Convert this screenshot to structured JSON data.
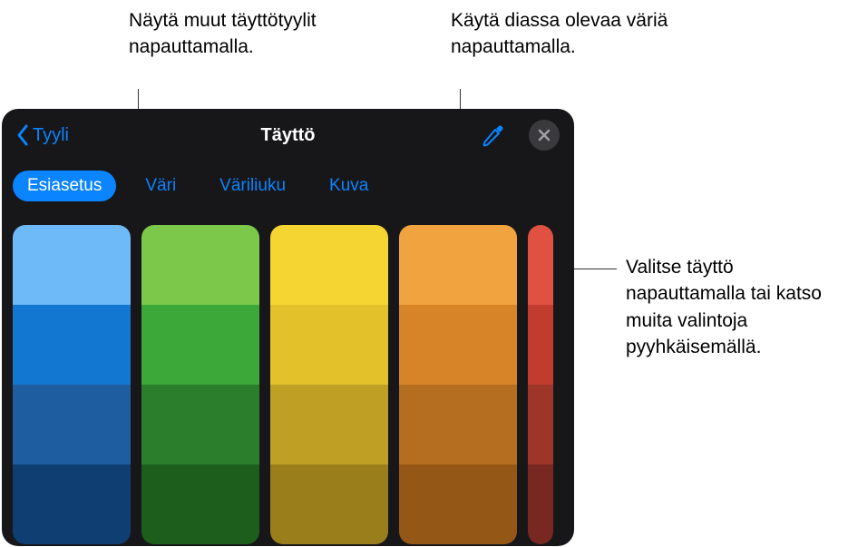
{
  "callouts": {
    "top_left": "Näytä muut täyttötyylit napauttamalla.",
    "top_right": "Käytä diassa olevaa väriä napauttamalla.",
    "side_right": "Valitse täyttö napauttamalla tai katso muita valintoja pyyhkäisemällä."
  },
  "panel": {
    "back_label": "Tyyli",
    "title": "Täyttö",
    "tabs": [
      {
        "label": "Esiasetus",
        "active": true
      },
      {
        "label": "Väri",
        "active": false
      },
      {
        "label": "Väriliuku",
        "active": false
      },
      {
        "label": "Kuva",
        "active": false
      }
    ],
    "icons": {
      "back": "chevron-left-icon",
      "eyedropper": "eyedropper-icon",
      "close": "close-icon"
    }
  },
  "swatches": {
    "columns": [
      [
        "#6eb9f7",
        "#1177d1",
        "#1e5da0",
        "#0f3e72"
      ],
      [
        "#7cc84b",
        "#3ca83a",
        "#2b7f2c",
        "#1d5e1d"
      ],
      [
        "#f5d531",
        "#e3c12a",
        "#c09f25",
        "#9a7e1c"
      ],
      [
        "#f0a33e",
        "#d78428",
        "#b56d1f",
        "#945716"
      ],
      [
        "#e05142",
        "#c13c2f",
        "#9d3528",
        "#782820"
      ]
    ]
  }
}
